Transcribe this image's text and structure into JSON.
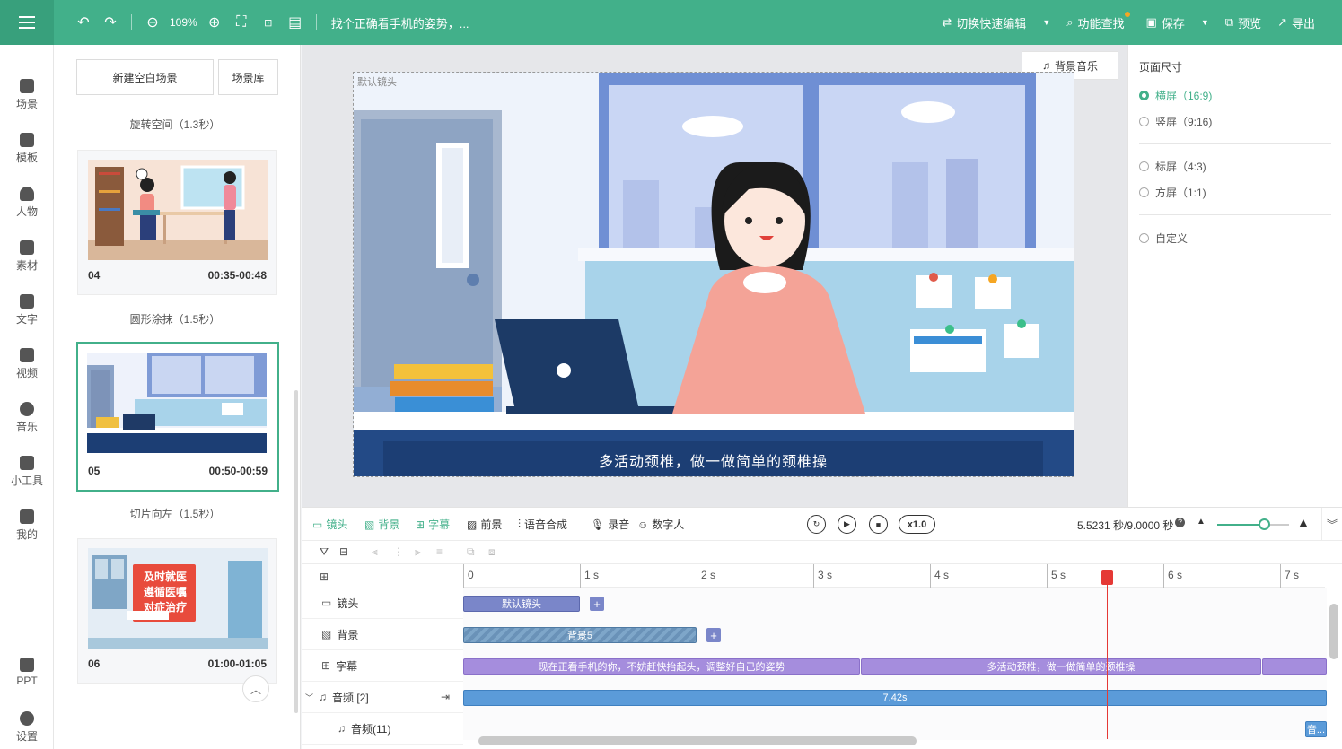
{
  "topbar": {
    "zoom": "109%",
    "title": "找个正确看手机的姿势，...",
    "switch_label": "切换快速编辑",
    "find_label": "功能查找",
    "save_label": "保存",
    "preview_label": "预览",
    "export_label": "导出",
    "accent": "#42b08a"
  },
  "sidebar": {
    "items": [
      {
        "label": "场景",
        "icon": "scene-icon"
      },
      {
        "label": "模板",
        "icon": "template-icon"
      },
      {
        "label": "人物",
        "icon": "person-icon"
      },
      {
        "label": "素材",
        "icon": "material-icon"
      },
      {
        "label": "文字",
        "icon": "text-icon"
      },
      {
        "label": "视频",
        "icon": "video-icon"
      },
      {
        "label": "音乐",
        "icon": "music-icon"
      },
      {
        "label": "小工具",
        "icon": "toolbox-icon"
      },
      {
        "label": "我的",
        "icon": "upload-icon"
      },
      {
        "label": "PPT",
        "icon": "ppt-icon"
      },
      {
        "label": "设置",
        "icon": "gear-icon"
      }
    ]
  },
  "scenes": {
    "new_blank": "新建空白场景",
    "library": "场景库",
    "transitions": [
      "旋转空间（1.3秒）",
      "圆形涂抹（1.5秒）",
      "切片向左（1.5秒）"
    ],
    "cards": [
      {
        "no": "04",
        "time": "00:35-00:48"
      },
      {
        "no": "05",
        "time": "00:50-00:59"
      },
      {
        "no": "06",
        "time": "01:00-01:05"
      }
    ],
    "card06_sign": [
      "及时就医",
      "遵循医嘱",
      "对症治疗"
    ]
  },
  "canvas": {
    "bgm": "背景音乐",
    "shot_label": "默认镜头",
    "subtitle": "多活动颈椎，做一做简单的颈椎操"
  },
  "page_size": {
    "title": "页面尺寸",
    "options": [
      "横屏（16:9)",
      "竖屏（9:16)",
      "标屏（4:3)",
      "方屏（1:1)",
      "自定义"
    ],
    "selected": "横屏（16:9)"
  },
  "timeline": {
    "tools": [
      "镜头",
      "背景",
      "字幕",
      "前景",
      "语音合成",
      "录音",
      "数字人"
    ],
    "speed": "x1.0",
    "time_readout": "5.5231 秒/9.0000 秒",
    "ticks": [
      "0",
      "1 s",
      "2 s",
      "3 s",
      "4 s",
      "5 s",
      "6 s",
      "7 s"
    ],
    "tracks": [
      "镜头",
      "背景",
      "字幕",
      "音频 [2]",
      "音频(11)"
    ],
    "clips": {
      "shot": "默认镜头",
      "background": "背景5",
      "sub1": "现在正看手机的你，不妨赶快抬起头，调整好自己的姿势",
      "sub2": "多活动颈椎，做一做简单的颈椎操",
      "audio": "7.42s",
      "audio_small": "音..."
    },
    "playhead_seconds": 5.5231,
    "duration_seconds": 9.0
  }
}
